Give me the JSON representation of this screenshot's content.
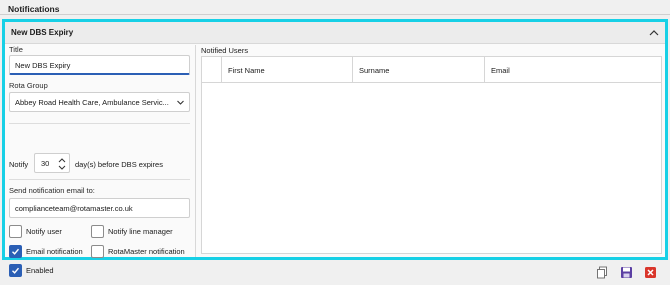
{
  "section": {
    "title": "Notifications"
  },
  "panel": {
    "title": "New DBS Expiry"
  },
  "form": {
    "title_label": "Title",
    "title_value": "New DBS Expiry",
    "rota_group_label": "Rota Group",
    "rota_group_value": "Abbey Road Health Care, Ambulance Servic...",
    "notify_label": "Notify",
    "notify_days": "30",
    "days_suffix": "day(s) before DBS expires",
    "email_label": "Send notification email to:",
    "email_value": "complianceteam@rotamaster.co.uk",
    "checkboxes": [
      {
        "label": "Notify user",
        "checked": false
      },
      {
        "label": "Notify line manager",
        "checked": false
      },
      {
        "label": "Email notification",
        "checked": true
      },
      {
        "label": "RotaMaster notification",
        "checked": false
      },
      {
        "label": "Enabled",
        "checked": true
      }
    ]
  },
  "users": {
    "label": "Notified Users",
    "columns": [
      "First Name",
      "Surname",
      "Email"
    ]
  },
  "colors": {
    "highlight": "#17d0e6",
    "accent": "#2b5fb5",
    "delete": "#d9362b",
    "save": "#5b3fa3"
  },
  "icons": {
    "collapse": "chevron-up-icon",
    "dropdown": "chevron-down-icon",
    "copy": "copy-icon",
    "save": "save-icon",
    "delete": "delete-icon"
  }
}
